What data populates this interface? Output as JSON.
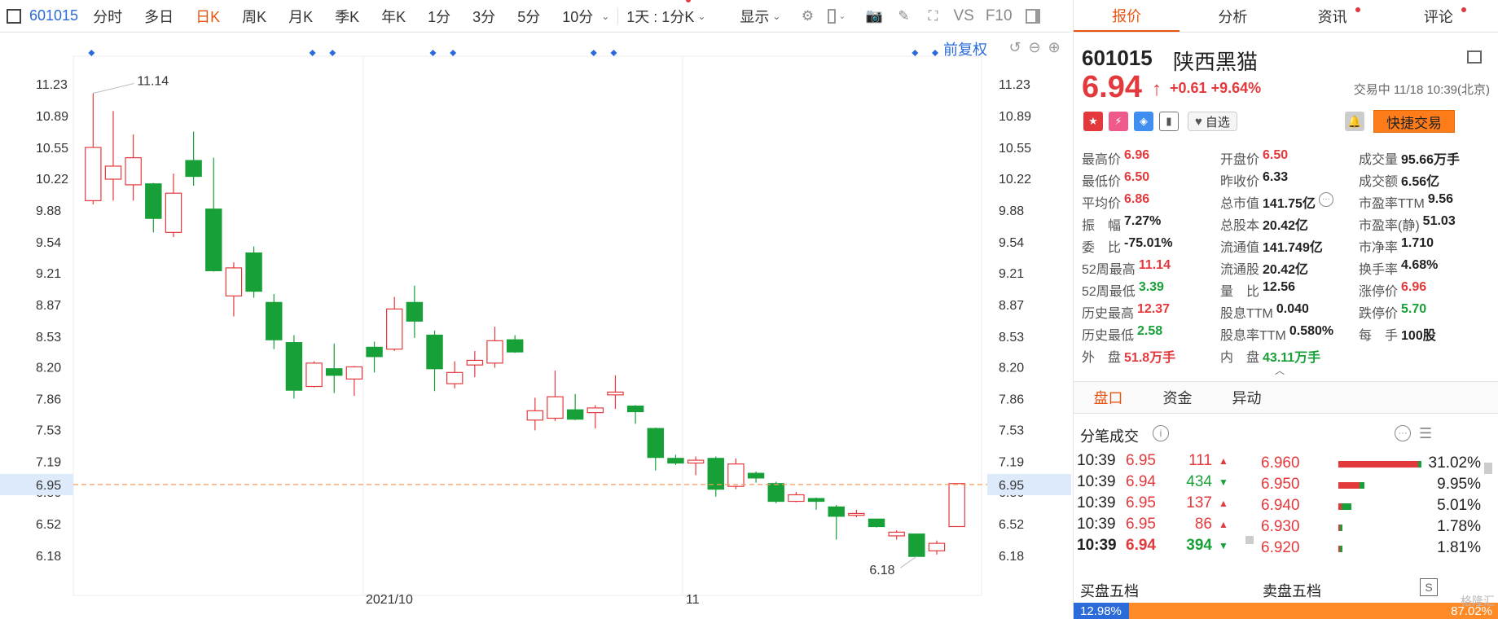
{
  "toolbar": {
    "code": "601015",
    "periods": [
      "分时",
      "多日",
      "日K",
      "周K",
      "月K",
      "季K",
      "年K",
      "1分",
      "3分",
      "5分",
      "10分"
    ],
    "active_period": "日K",
    "multi_period": "1天 : 1分K",
    "display_label": "显示",
    "vs_label": "VS",
    "f10_label": "F10"
  },
  "chart": {
    "fuquan_label": "前复权",
    "y_ticks": [
      "11.23",
      "10.89",
      "10.55",
      "10.22",
      "9.88",
      "9.54",
      "9.21",
      "8.87",
      "8.53",
      "8.20",
      "7.86",
      "7.53",
      "7.19",
      "6.86",
      "6.52",
      "6.18"
    ],
    "current_price_tag": "6.95",
    "x_labels": [
      "2021/10",
      "11"
    ],
    "high_label": "11.14",
    "low_label": "6.18"
  },
  "chart_data": {
    "type": "candlestick",
    "ylim": [
      5.85,
      11.45
    ],
    "current_price": 6.95,
    "x_labels": [
      "2021/10",
      "11"
    ],
    "candles": [
      {
        "o": 9.99,
        "c": 10.56,
        "h": 11.14,
        "l": 9.95
      },
      {
        "o": 10.22,
        "c": 10.36,
        "h": 10.95,
        "l": 9.99
      },
      {
        "o": 10.16,
        "c": 10.45,
        "h": 10.7,
        "l": 9.99
      },
      {
        "o": 10.17,
        "c": 9.8,
        "h": 10.18,
        "l": 9.65
      },
      {
        "o": 9.65,
        "c": 10.07,
        "h": 10.28,
        "l": 9.6
      },
      {
        "o": 10.42,
        "c": 10.25,
        "h": 10.73,
        "l": 10.15
      },
      {
        "o": 9.9,
        "c": 9.24,
        "h": 10.45,
        "l": 9.23
      },
      {
        "o": 8.97,
        "c": 9.27,
        "h": 9.33,
        "l": 8.75
      },
      {
        "o": 9.43,
        "c": 9.02,
        "h": 9.5,
        "l": 8.95
      },
      {
        "o": 8.9,
        "c": 8.5,
        "h": 8.99,
        "l": 8.4
      },
      {
        "o": 8.47,
        "c": 7.96,
        "h": 8.55,
        "l": 7.87
      },
      {
        "o": 8.0,
        "c": 8.25,
        "h": 8.27,
        "l": 7.99
      },
      {
        "o": 8.19,
        "c": 8.12,
        "h": 8.46,
        "l": 7.93
      },
      {
        "o": 8.08,
        "c": 8.21,
        "h": 8.22,
        "l": 7.9
      },
      {
        "o": 8.42,
        "c": 8.32,
        "h": 8.48,
        "l": 8.15
      },
      {
        "o": 8.4,
        "c": 8.83,
        "h": 8.96,
        "l": 8.38
      },
      {
        "o": 8.9,
        "c": 8.7,
        "h": 9.08,
        "l": 8.52
      },
      {
        "o": 8.55,
        "c": 8.19,
        "h": 8.6,
        "l": 7.95
      },
      {
        "o": 8.03,
        "c": 8.15,
        "h": 8.27,
        "l": 7.98
      },
      {
        "o": 8.23,
        "c": 8.28,
        "h": 8.38,
        "l": 8.1
      },
      {
        "o": 8.25,
        "c": 8.49,
        "h": 8.64,
        "l": 8.2
      },
      {
        "o": 8.5,
        "c": 8.37,
        "h": 8.55,
        "l": 8.36
      },
      {
        "o": 7.64,
        "c": 7.74,
        "h": 7.88,
        "l": 7.53
      },
      {
        "o": 7.66,
        "c": 7.89,
        "h": 8.17,
        "l": 7.63
      },
      {
        "o": 7.75,
        "c": 7.65,
        "h": 7.92,
        "l": 7.64
      },
      {
        "o": 7.72,
        "c": 7.77,
        "h": 7.8,
        "l": 7.55
      },
      {
        "o": 7.91,
        "c": 7.94,
        "h": 8.12,
        "l": 7.76
      },
      {
        "o": 7.79,
        "c": 7.73,
        "h": 7.8,
        "l": 7.6
      },
      {
        "o": 7.55,
        "c": 7.24,
        "h": 7.56,
        "l": 7.1
      },
      {
        "o": 7.23,
        "c": 7.18,
        "h": 7.27,
        "l": 7.16
      },
      {
        "o": 7.18,
        "c": 7.21,
        "h": 7.25,
        "l": 7.05
      },
      {
        "o": 7.23,
        "c": 6.9,
        "h": 7.25,
        "l": 6.82
      },
      {
        "o": 6.93,
        "c": 7.17,
        "h": 7.23,
        "l": 6.9
      },
      {
        "o": 7.07,
        "c": 7.02,
        "h": 7.09,
        "l": 6.97
      },
      {
        "o": 6.96,
        "c": 6.77,
        "h": 6.98,
        "l": 6.75
      },
      {
        "o": 6.77,
        "c": 6.84,
        "h": 6.87,
        "l": 6.76
      },
      {
        "o": 6.8,
        "c": 6.77,
        "h": 6.81,
        "l": 6.68
      },
      {
        "o": 6.71,
        "c": 6.61,
        "h": 6.73,
        "l": 6.36
      },
      {
        "o": 6.62,
        "c": 6.64,
        "h": 6.68,
        "l": 6.6
      },
      {
        "o": 6.58,
        "c": 6.5,
        "h": 6.58,
        "l": 6.49
      },
      {
        "o": 6.4,
        "c": 6.44,
        "h": 6.46,
        "l": 6.36
      },
      {
        "o": 6.42,
        "c": 6.18,
        "h": 6.42,
        "l": 6.18
      },
      {
        "o": 6.24,
        "c": 6.32,
        "h": 6.35,
        "l": 6.2
      },
      {
        "o": 6.5,
        "c": 6.96,
        "h": 6.96,
        "l": 6.5
      }
    ],
    "markers_idx": [
      0,
      11,
      12,
      17,
      18,
      25,
      26,
      41,
      42
    ]
  },
  "tabs": [
    "报价",
    "分析",
    "资讯",
    "评论"
  ],
  "active_tab": "报价",
  "stock": {
    "code": "601015",
    "name": "陕西黑猫",
    "price": "6.94",
    "change": "+0.61",
    "change_pct": "+9.64%",
    "status": "交易中 11/18 10:39(北京)",
    "watch_label": "自选",
    "quick_trade_label": "快捷交易"
  },
  "stats": [
    [
      {
        "l": "最高价",
        "v": "6.96",
        "c": "red"
      },
      {
        "l": "开盘价",
        "v": "6.50",
        "c": "red"
      },
      {
        "l": "成交量",
        "v": "95.66万手",
        "c": ""
      }
    ],
    [
      {
        "l": "最低价",
        "v": "6.50",
        "c": "red"
      },
      {
        "l": "昨收价",
        "v": "6.33",
        "c": ""
      },
      {
        "l": "成交额",
        "v": "6.56亿",
        "c": ""
      }
    ],
    [
      {
        "l": "平均价",
        "v": "6.86",
        "c": "red"
      },
      {
        "l": "总市值",
        "v": "141.75亿",
        "c": ""
      },
      {
        "l": "市盈率TTM",
        "v": "9.56",
        "c": ""
      }
    ],
    [
      {
        "l": "振　幅",
        "v": "7.27%",
        "c": ""
      },
      {
        "l": "总股本",
        "v": "20.42亿",
        "c": ""
      },
      {
        "l": "市盈率(静)",
        "v": "51.03",
        "c": ""
      }
    ],
    [
      {
        "l": "委　比",
        "v": "-75.01%",
        "c": ""
      },
      {
        "l": "流通值",
        "v": "141.749亿",
        "c": ""
      },
      {
        "l": "市净率",
        "v": "1.710",
        "c": ""
      }
    ],
    [
      {
        "l": "52周最高",
        "v": "11.14",
        "c": "red"
      },
      {
        "l": "流通股",
        "v": "20.42亿",
        "c": ""
      },
      {
        "l": "换手率",
        "v": "4.68%",
        "c": ""
      }
    ],
    [
      {
        "l": "52周最低",
        "v": "3.39",
        "c": "green"
      },
      {
        "l": "量　比",
        "v": "12.56",
        "c": ""
      },
      {
        "l": "涨停价",
        "v": "6.96",
        "c": "red"
      }
    ],
    [
      {
        "l": "历史最高",
        "v": "12.37",
        "c": "red"
      },
      {
        "l": "股息TTM",
        "v": "0.040",
        "c": ""
      },
      {
        "l": "跌停价",
        "v": "5.70",
        "c": "green"
      }
    ],
    [
      {
        "l": "历史最低",
        "v": "2.58",
        "c": "green"
      },
      {
        "l": "股息率TTM",
        "v": "0.580%",
        "c": ""
      },
      {
        "l": "每　手",
        "v": "100股",
        "c": ""
      }
    ],
    [
      {
        "l": "外　盘",
        "v": "51.8万手",
        "c": "red"
      },
      {
        "l": "内　盘",
        "v": "43.11万手",
        "c": "green"
      }
    ]
  ],
  "sub_tabs": [
    "盘口",
    "资金",
    "异动"
  ],
  "active_sub_tab": "盘口",
  "fenbi_title": "分笔成交",
  "trades": [
    {
      "t": "10:39",
      "p": "6.95",
      "v": "111",
      "dir": "up"
    },
    {
      "t": "10:39",
      "p": "6.94",
      "v": "434",
      "dir": "down"
    },
    {
      "t": "10:39",
      "p": "6.95",
      "v": "137",
      "dir": "up"
    },
    {
      "t": "10:39",
      "p": "6.95",
      "v": "86",
      "dir": "up"
    },
    {
      "t": "10:39",
      "p": "6.94",
      "v": "394",
      "dir": "down"
    }
  ],
  "price_dist": [
    {
      "p": "6.960",
      "pct": "31.02%",
      "red": 98,
      "green": 4
    },
    {
      "p": "6.950",
      "pct": "9.95%",
      "red": 26,
      "green": 6
    },
    {
      "p": "6.940",
      "pct": "5.01%",
      "red": 4,
      "green": 12
    },
    {
      "p": "6.930",
      "pct": "1.78%",
      "red": 2,
      "green": 3
    },
    {
      "p": "6.920",
      "pct": "1.81%",
      "red": 2,
      "green": 3
    }
  ],
  "buy_title": "买盘五档",
  "sell_title": "卖盘五档",
  "ratio": {
    "buy": "12.98%",
    "sell": "87.02%"
  },
  "watermark": "格隆汇",
  "colors": {
    "up": "#e4393c",
    "down": "#18a038",
    "accent": "#e8540f",
    "link": "#2a6ad9"
  }
}
